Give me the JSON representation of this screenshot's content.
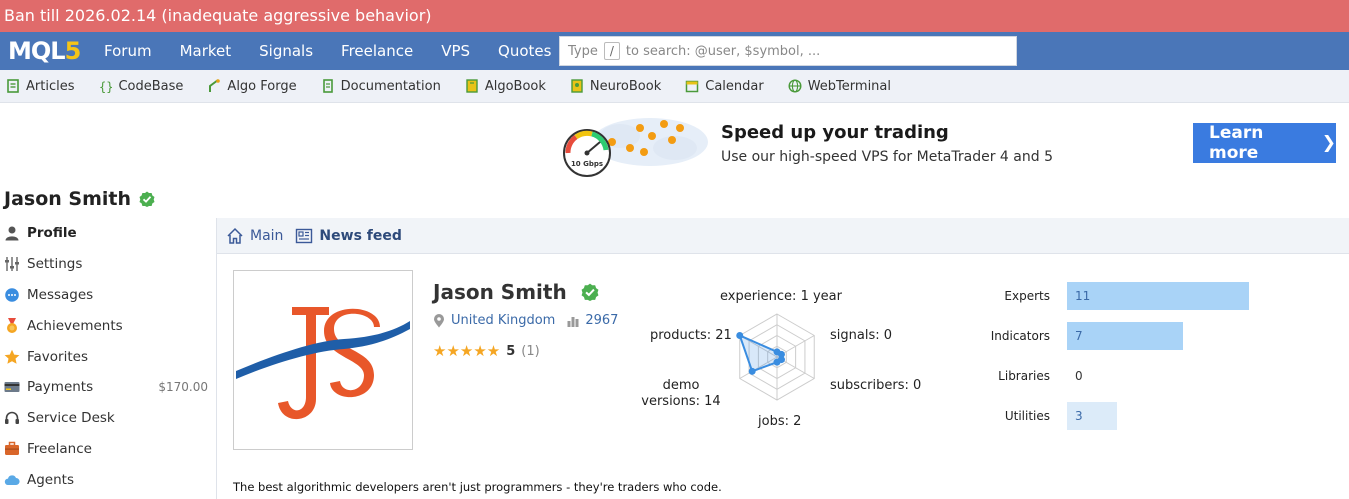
{
  "ban": {
    "text": "Ban till 2026.02.14 (inadequate aggressive behavior)"
  },
  "header": {
    "logo_main": "MQL",
    "logo_num": "5",
    "nav": [
      "Forum",
      "Market",
      "Signals",
      "Freelance",
      "VPS",
      "Quotes"
    ],
    "search": {
      "prefix": "Type",
      "key": "/",
      "suffix": "to search: @user, $symbol, ..."
    }
  },
  "subnav": [
    "Articles",
    "CodeBase",
    "Algo Forge",
    "Documentation",
    "AlgoBook",
    "NeuroBook",
    "Calendar",
    "WebTerminal"
  ],
  "banner": {
    "speed_label": "10 Gbps",
    "title": "Speed up your trading",
    "subtitle": "Use our high-speed VPS for MetaTrader 4 and 5",
    "cta": "Learn more",
    "cta_chevron": "❯"
  },
  "profile_header": {
    "name": "Jason Smith"
  },
  "sidebar": {
    "items": [
      {
        "label": "Profile",
        "icon": "user-icon"
      },
      {
        "label": "Settings",
        "icon": "sliders-icon"
      },
      {
        "label": "Messages",
        "icon": "chat-bubble-icon"
      },
      {
        "label": "Achievements",
        "icon": "medal-icon"
      },
      {
        "label": "Favorites",
        "icon": "star-icon"
      },
      {
        "label": "Payments",
        "icon": "credit-card-icon",
        "amount": "$170.00"
      },
      {
        "label": "Service Desk",
        "icon": "headset-icon"
      },
      {
        "label": "Freelance",
        "icon": "briefcase-icon"
      },
      {
        "label": "Agents",
        "icon": "cloud-icon"
      }
    ]
  },
  "tabs": [
    {
      "label": "Main",
      "icon": "home-icon"
    },
    {
      "label": "News feed",
      "icon": "newspaper-icon"
    }
  ],
  "user": {
    "name": "Jason Smith",
    "country": "United Kingdom",
    "rating": "2967",
    "stars": "★★★★★",
    "score": "5",
    "reviews": "(1)",
    "bio": "The best algorithmic developers aren't just programmers - they're traders who code."
  },
  "colors": {
    "accent": "#4a76b8",
    "ban": "#e06b6b",
    "cta": "#3a7be0",
    "verified": "#4caf50",
    "bar": "#a9d3f7"
  },
  "chart_data": [
    {
      "type": "radar",
      "axes": [
        {
          "label": "experience: 1 year",
          "value": 1
        },
        {
          "label": "signals: 0",
          "value": 0
        },
        {
          "label": "subscribers: 0",
          "value": 0
        },
        {
          "label": "jobs: 2",
          "value": 2
        },
        {
          "label": "demo versions: 14",
          "value": 14
        },
        {
          "label": "products: 21",
          "value": 21
        }
      ],
      "max": 21
    },
    {
      "type": "bar",
      "orientation": "horizontal",
      "categories": [
        "Experts",
        "Indicators",
        "Libraries",
        "Utilities"
      ],
      "values": [
        11,
        7,
        0,
        3
      ],
      "labels": [
        "11",
        "7",
        "0",
        "3"
      ],
      "xlim": [
        0,
        11
      ]
    }
  ]
}
